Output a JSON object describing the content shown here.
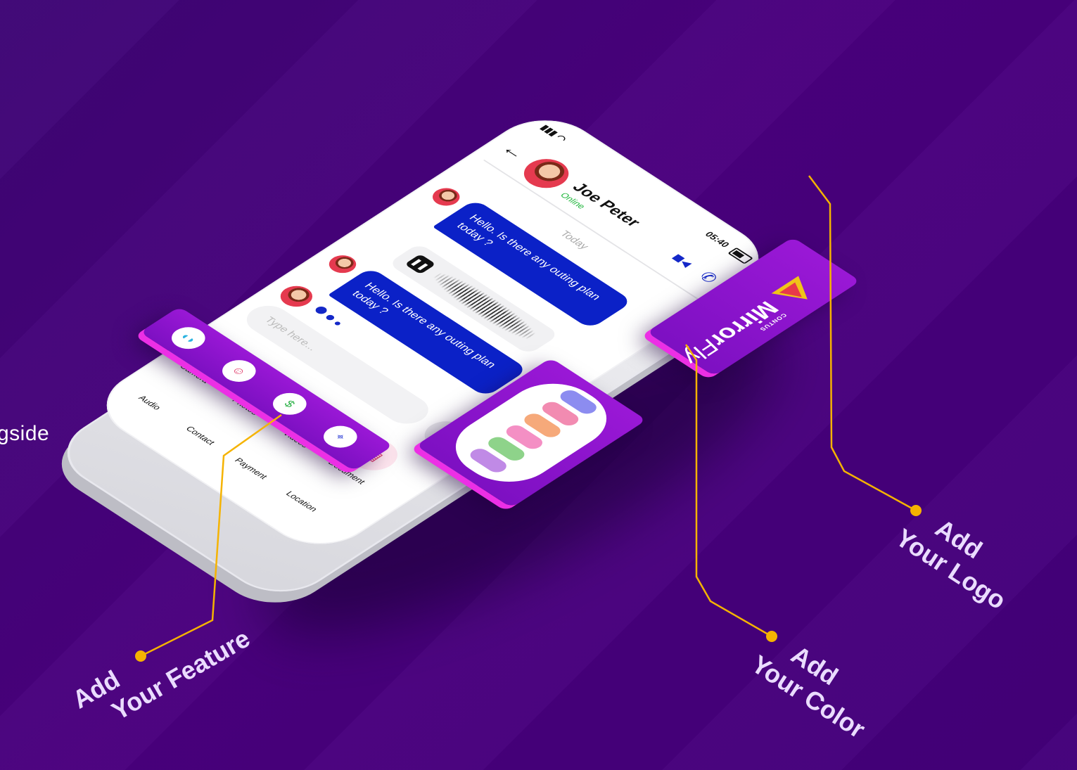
{
  "side_text": "gside",
  "phone": {
    "status_time": "05:40",
    "back_icon": "arrow-left-icon",
    "contact_name": "Joe Peter",
    "contact_status": "Online",
    "date_divider": "Today",
    "messages": [
      {
        "text": "Hello. Is there any outing plan today ?"
      },
      {
        "text": "Hello. Is there any outing plan today ?"
      }
    ],
    "input_placeholder": "Type here...",
    "attachments": [
      {
        "label": "Camera",
        "icon": "camera-icon"
      },
      {
        "label": "Photos",
        "icon": "image-icon"
      },
      {
        "label": "Videos",
        "icon": "video-icon"
      },
      {
        "label": "Document",
        "icon": "document-icon"
      }
    ],
    "features": [
      {
        "label": "Audio",
        "icon": "headphones-icon"
      },
      {
        "label": "Contact",
        "icon": "user-icon"
      },
      {
        "label": "Payment",
        "icon": "dollar-icon"
      },
      {
        "label": "Location",
        "icon": "location-pin-icon"
      }
    ]
  },
  "logo": {
    "small": "CONTUS",
    "brand_main": "Mirror",
    "brand_accent": "Fly"
  },
  "color_swatches": [
    "#8c8cf0",
    "#f28bb1",
    "#f6a97a",
    "#f48fc4",
    "#8ed38a",
    "#c08ae6"
  ],
  "colors": {
    "background": "#4a007e",
    "accent_purple": "#9a18d6",
    "accent_pink": "#ec2fe5",
    "callout_line": "#f5b301",
    "message_blue": "#0b21c7"
  },
  "callouts": {
    "feature": {
      "line1": "Add",
      "line2": "Your Feature"
    },
    "color": {
      "line1": "Add",
      "line2": "Your Color"
    },
    "logo": {
      "line1": "Add",
      "line2": "Your Logo"
    }
  }
}
